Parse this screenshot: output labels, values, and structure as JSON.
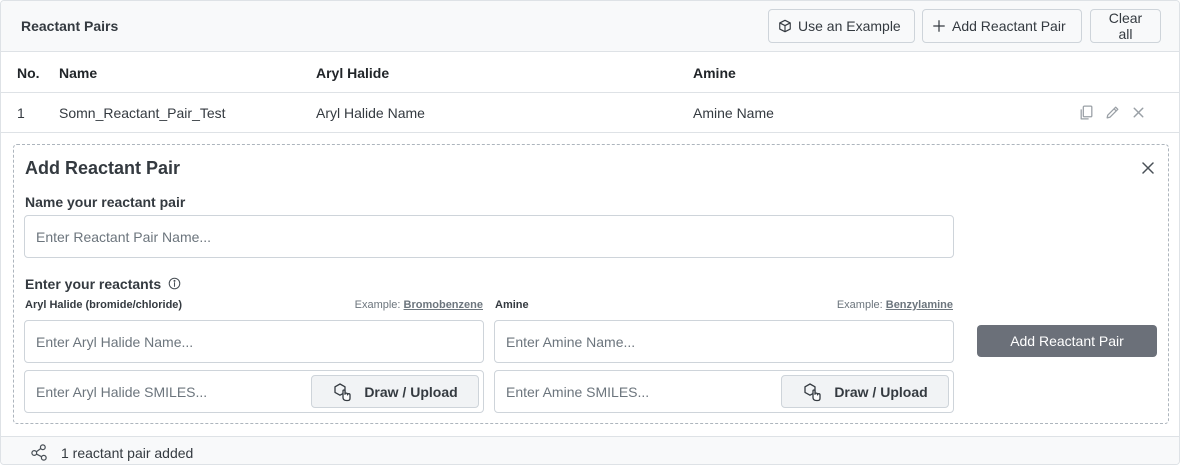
{
  "header": {
    "title": "Reactant Pairs",
    "use_example_label": "Use an Example",
    "add_pair_label": "Add Reactant Pair",
    "clear_all_label": "Clear all"
  },
  "table": {
    "columns": [
      "No.",
      "Name",
      "Aryl Halide",
      "Amine"
    ],
    "rows": [
      {
        "no": "1",
        "name": "Somn_Reactant_Pair_Test",
        "aryl_halide": "Aryl Halide Name",
        "amine": "Amine Name"
      }
    ]
  },
  "form": {
    "title": "Add Reactant Pair",
    "name_label": "Name your reactant pair",
    "name_placeholder": "Enter Reactant Pair Name...",
    "reactants_label": "Enter your reactants",
    "aryl": {
      "label": "Aryl Halide (bromide/chloride)",
      "example_prefix": "Example:",
      "example_value": "Bromobenzene",
      "name_placeholder": "Enter Aryl Halide Name...",
      "smiles_placeholder": "Enter Aryl Halide SMILES...",
      "draw_label": "Draw / Upload"
    },
    "amine": {
      "label": "Amine",
      "example_prefix": "Example:",
      "example_value": "Benzylamine",
      "name_placeholder": "Enter Amine Name...",
      "smiles_placeholder": "Enter Amine SMILES...",
      "draw_label": "Draw / Upload"
    },
    "submit_label": "Add Reactant Pair"
  },
  "footer": {
    "status": "1 reactant pair added"
  },
  "icons": {
    "example": "cube-icon",
    "add": "plus-icon",
    "copy": "copy-icon",
    "edit": "pencil-icon",
    "delete": "close-icon",
    "info": "info-icon",
    "draw": "molecule-hand-icon",
    "footer": "share-nodes-icon"
  },
  "colors": {
    "primary_button": "#6b7079",
    "header_bg": "#f8f9fa",
    "border": "#dee2e6"
  }
}
